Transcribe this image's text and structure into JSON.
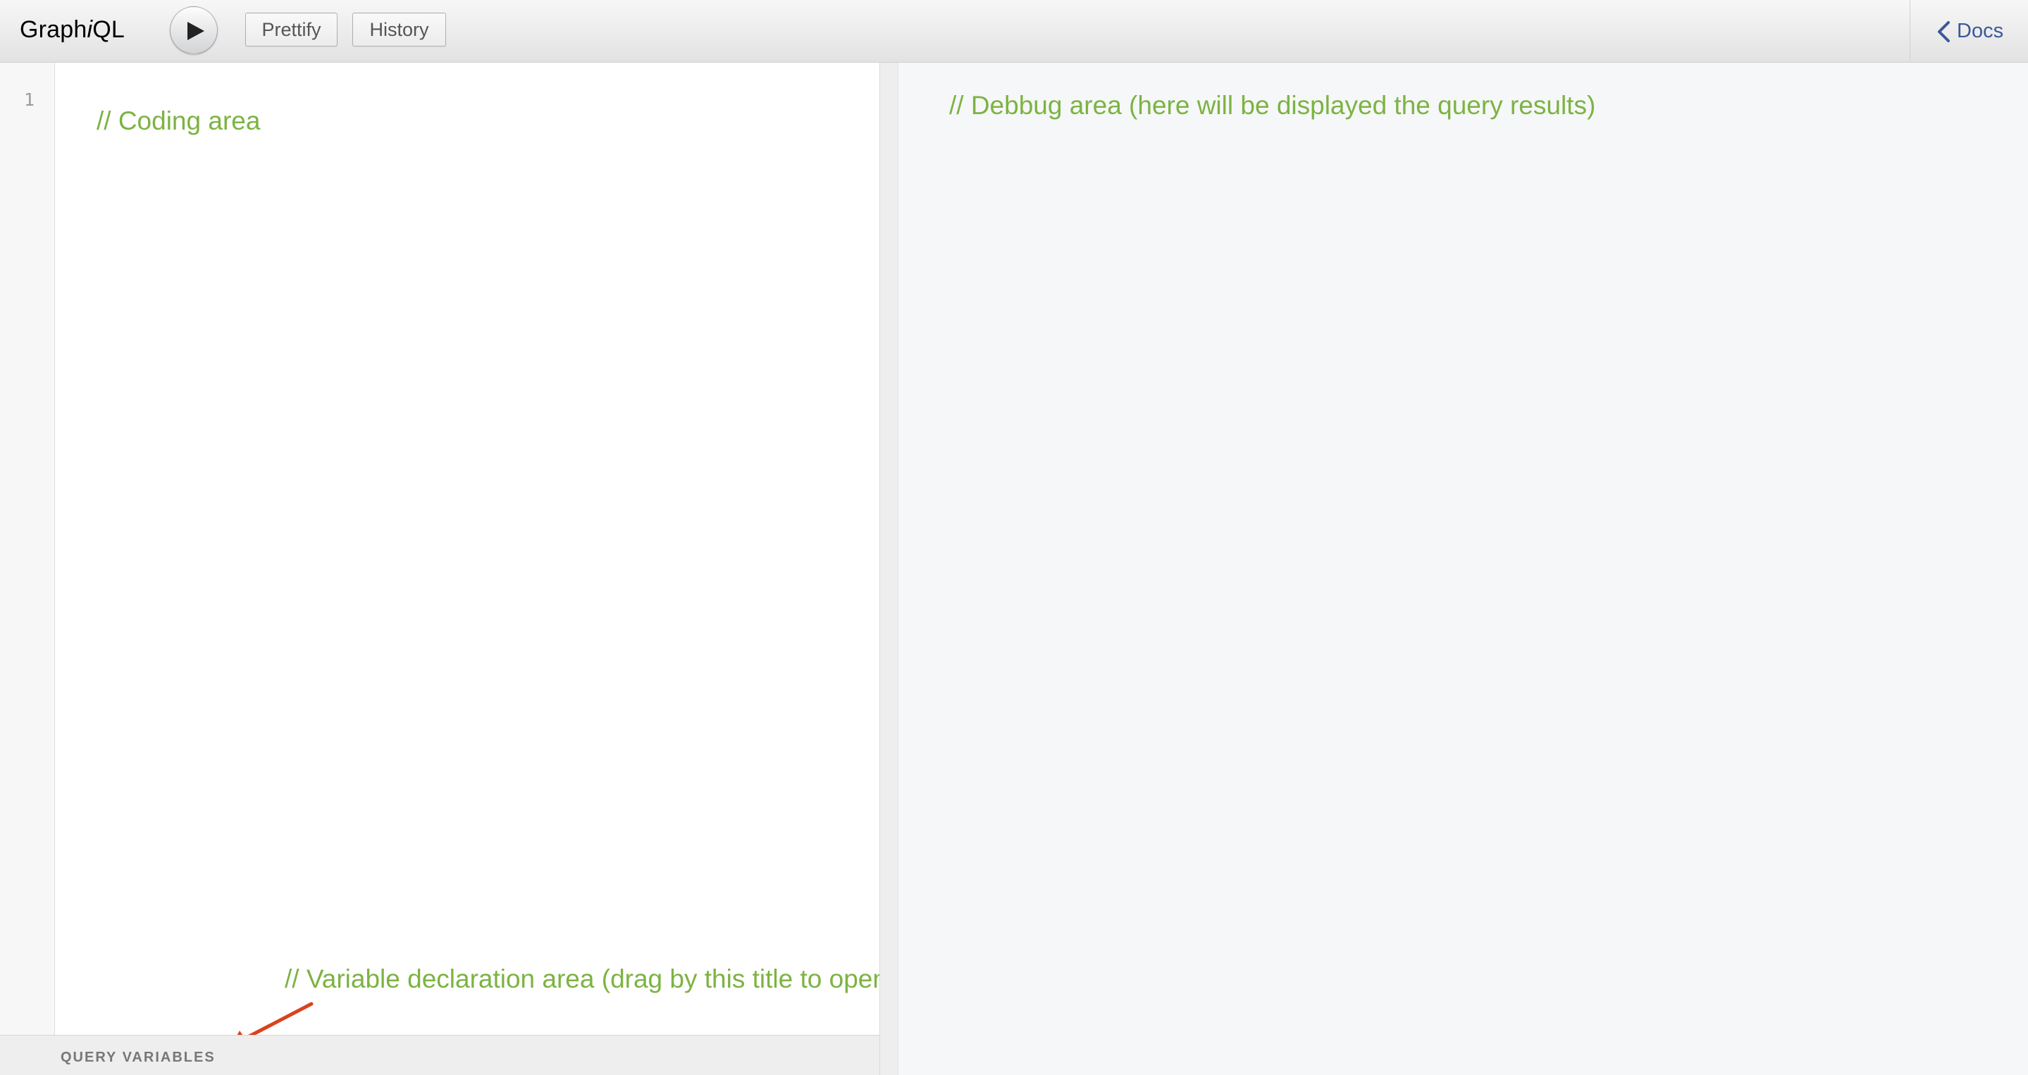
{
  "app": {
    "logo_prefix": "Graph",
    "logo_italic": "i",
    "logo_suffix": "QL"
  },
  "toolbar": {
    "execute_icon": "play-icon",
    "prettify_label": "Prettify",
    "history_label": "History",
    "docs_label": "Docs",
    "docs_icon": "chevron-left-icon"
  },
  "editor": {
    "line_numbers": [
      "1"
    ],
    "coding_comment": "// Coding area",
    "variable_comment": "// Variable declaration area (drag by this title to open)",
    "query_variables_title": "QUERY VARIABLES"
  },
  "result": {
    "debug_comment": "// Debbug area (here will be displayed the query results)"
  },
  "colors": {
    "comment_green": "#7cb342",
    "docs_link": "#3b5998",
    "annotation_arrow": "#d9431e",
    "result_background": "#f6f7f8"
  }
}
